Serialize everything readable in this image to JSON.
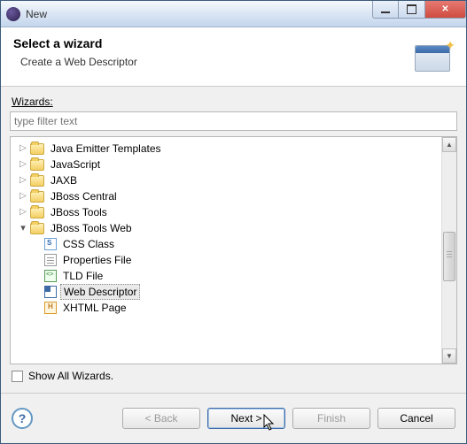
{
  "titlebar": {
    "title": "New"
  },
  "header": {
    "title": "Select a wizard",
    "description": "Create a Web Descriptor"
  },
  "wizards_label": "Wizards:",
  "filter_placeholder": "type filter text",
  "tree": {
    "items": [
      {
        "label": "Java Emitter Templates"
      },
      {
        "label": "JavaScript"
      },
      {
        "label": "JAXB"
      },
      {
        "label": "JBoss Central"
      },
      {
        "label": "JBoss Tools"
      },
      {
        "label": "JBoss Tools Web"
      }
    ],
    "children": [
      {
        "label": "CSS Class"
      },
      {
        "label": "Properties File"
      },
      {
        "label": "TLD File"
      },
      {
        "label": "Web Descriptor"
      },
      {
        "label": "XHTML Page"
      }
    ]
  },
  "show_all_label": "Show All Wizards.",
  "buttons": {
    "back": "< Back",
    "next": "Next >",
    "finish": "Finish",
    "cancel": "Cancel"
  }
}
